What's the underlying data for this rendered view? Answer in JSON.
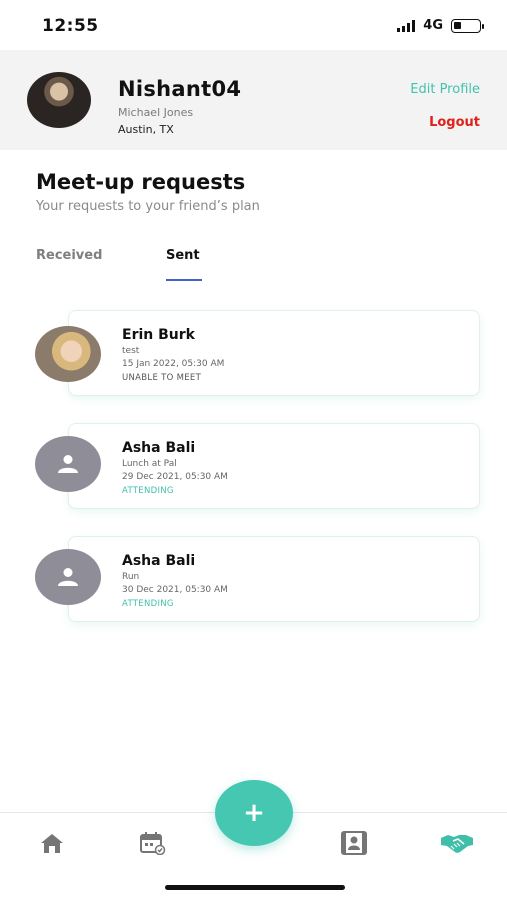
{
  "status_bar": {
    "time": "12:55",
    "network": "4G"
  },
  "profile": {
    "username": "Nishant04",
    "full_name": "Michael Jones",
    "location": "Austin, TX",
    "edit_label": "Edit Profile",
    "logout_label": "Logout"
  },
  "page": {
    "title": "Meet-up requests",
    "subtitle": "Your requests to your friend’s plan"
  },
  "tabs": [
    {
      "label": "Received",
      "active": false
    },
    {
      "label": "Sent",
      "active": true
    }
  ],
  "requests": [
    {
      "name": "Erin Burk",
      "plan": "test",
      "datetime": "15 Jan 2022, 05:30 AM",
      "status": "UNABLE TO MEET",
      "avatar": "photo"
    },
    {
      "name": "Asha Bali",
      "plan": "Lunch at Pal",
      "datetime": "29 Dec 2021, 05:30 AM",
      "status": "ATTENDING",
      "avatar": "user-placeholder-icon"
    },
    {
      "name": "Asha Bali",
      "plan": "Run",
      "datetime": "30 Dec 2021, 05:30 AM",
      "status": "ATTENDING",
      "avatar": "user-placeholder-icon"
    }
  ],
  "bottom_nav": {
    "items": [
      "home-icon",
      "calendar-icon",
      "add-icon",
      "contacts-icon",
      "handshake-icon"
    ],
    "active": "handshake-icon",
    "fab_label": "+"
  },
  "colors": {
    "accent": "#40c3b0",
    "logout": "#e0201a",
    "tab_underline": "#3e63c9",
    "placeholder_avatar": "#8e8d98"
  }
}
